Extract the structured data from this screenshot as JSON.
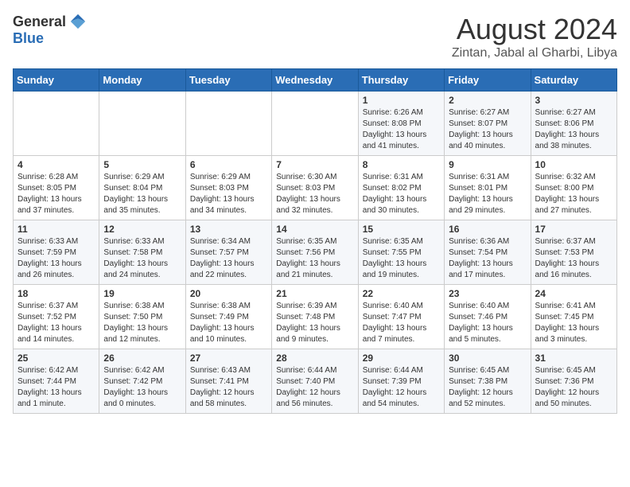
{
  "header": {
    "logo_general": "General",
    "logo_blue": "Blue",
    "month_title": "August 2024",
    "location": "Zintan, Jabal al Gharbi, Libya"
  },
  "days_of_week": [
    "Sunday",
    "Monday",
    "Tuesday",
    "Wednesday",
    "Thursday",
    "Friday",
    "Saturday"
  ],
  "weeks": [
    [
      {
        "day": "",
        "info": ""
      },
      {
        "day": "",
        "info": ""
      },
      {
        "day": "",
        "info": ""
      },
      {
        "day": "",
        "info": ""
      },
      {
        "day": "1",
        "info": "Sunrise: 6:26 AM\nSunset: 8:08 PM\nDaylight: 13 hours and 41 minutes."
      },
      {
        "day": "2",
        "info": "Sunrise: 6:27 AM\nSunset: 8:07 PM\nDaylight: 13 hours and 40 minutes."
      },
      {
        "day": "3",
        "info": "Sunrise: 6:27 AM\nSunset: 8:06 PM\nDaylight: 13 hours and 38 minutes."
      }
    ],
    [
      {
        "day": "4",
        "info": "Sunrise: 6:28 AM\nSunset: 8:05 PM\nDaylight: 13 hours and 37 minutes."
      },
      {
        "day": "5",
        "info": "Sunrise: 6:29 AM\nSunset: 8:04 PM\nDaylight: 13 hours and 35 minutes."
      },
      {
        "day": "6",
        "info": "Sunrise: 6:29 AM\nSunset: 8:03 PM\nDaylight: 13 hours and 34 minutes."
      },
      {
        "day": "7",
        "info": "Sunrise: 6:30 AM\nSunset: 8:03 PM\nDaylight: 13 hours and 32 minutes."
      },
      {
        "day": "8",
        "info": "Sunrise: 6:31 AM\nSunset: 8:02 PM\nDaylight: 13 hours and 30 minutes."
      },
      {
        "day": "9",
        "info": "Sunrise: 6:31 AM\nSunset: 8:01 PM\nDaylight: 13 hours and 29 minutes."
      },
      {
        "day": "10",
        "info": "Sunrise: 6:32 AM\nSunset: 8:00 PM\nDaylight: 13 hours and 27 minutes."
      }
    ],
    [
      {
        "day": "11",
        "info": "Sunrise: 6:33 AM\nSunset: 7:59 PM\nDaylight: 13 hours and 26 minutes."
      },
      {
        "day": "12",
        "info": "Sunrise: 6:33 AM\nSunset: 7:58 PM\nDaylight: 13 hours and 24 minutes."
      },
      {
        "day": "13",
        "info": "Sunrise: 6:34 AM\nSunset: 7:57 PM\nDaylight: 13 hours and 22 minutes."
      },
      {
        "day": "14",
        "info": "Sunrise: 6:35 AM\nSunset: 7:56 PM\nDaylight: 13 hours and 21 minutes."
      },
      {
        "day": "15",
        "info": "Sunrise: 6:35 AM\nSunset: 7:55 PM\nDaylight: 13 hours and 19 minutes."
      },
      {
        "day": "16",
        "info": "Sunrise: 6:36 AM\nSunset: 7:54 PM\nDaylight: 13 hours and 17 minutes."
      },
      {
        "day": "17",
        "info": "Sunrise: 6:37 AM\nSunset: 7:53 PM\nDaylight: 13 hours and 16 minutes."
      }
    ],
    [
      {
        "day": "18",
        "info": "Sunrise: 6:37 AM\nSunset: 7:52 PM\nDaylight: 13 hours and 14 minutes."
      },
      {
        "day": "19",
        "info": "Sunrise: 6:38 AM\nSunset: 7:50 PM\nDaylight: 13 hours and 12 minutes."
      },
      {
        "day": "20",
        "info": "Sunrise: 6:38 AM\nSunset: 7:49 PM\nDaylight: 13 hours and 10 minutes."
      },
      {
        "day": "21",
        "info": "Sunrise: 6:39 AM\nSunset: 7:48 PM\nDaylight: 13 hours and 9 minutes."
      },
      {
        "day": "22",
        "info": "Sunrise: 6:40 AM\nSunset: 7:47 PM\nDaylight: 13 hours and 7 minutes."
      },
      {
        "day": "23",
        "info": "Sunrise: 6:40 AM\nSunset: 7:46 PM\nDaylight: 13 hours and 5 minutes."
      },
      {
        "day": "24",
        "info": "Sunrise: 6:41 AM\nSunset: 7:45 PM\nDaylight: 13 hours and 3 minutes."
      }
    ],
    [
      {
        "day": "25",
        "info": "Sunrise: 6:42 AM\nSunset: 7:44 PM\nDaylight: 13 hours and 1 minute."
      },
      {
        "day": "26",
        "info": "Sunrise: 6:42 AM\nSunset: 7:42 PM\nDaylight: 13 hours and 0 minutes."
      },
      {
        "day": "27",
        "info": "Sunrise: 6:43 AM\nSunset: 7:41 PM\nDaylight: 12 hours and 58 minutes."
      },
      {
        "day": "28",
        "info": "Sunrise: 6:44 AM\nSunset: 7:40 PM\nDaylight: 12 hours and 56 minutes."
      },
      {
        "day": "29",
        "info": "Sunrise: 6:44 AM\nSunset: 7:39 PM\nDaylight: 12 hours and 54 minutes."
      },
      {
        "day": "30",
        "info": "Sunrise: 6:45 AM\nSunset: 7:38 PM\nDaylight: 12 hours and 52 minutes."
      },
      {
        "day": "31",
        "info": "Sunrise: 6:45 AM\nSunset: 7:36 PM\nDaylight: 12 hours and 50 minutes."
      }
    ]
  ]
}
